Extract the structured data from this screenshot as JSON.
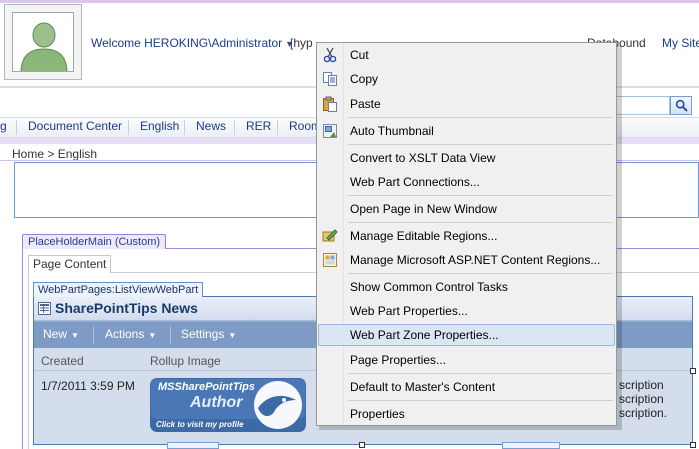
{
  "header": {
    "welcome": "Welcome HEROKING\\Administrator",
    "hyperlink_prefix": "[hyp",
    "databound": "Databound",
    "my_site": "My Site"
  },
  "search": {
    "placeholder": ""
  },
  "nav": {
    "items": [
      "g",
      "Document Center",
      "English",
      "News",
      "RER",
      "Room"
    ]
  },
  "breadcrumb": {
    "home": "Home",
    "separator": ">",
    "current": "English"
  },
  "placeholder": {
    "label": "PlaceHolderMain (Custom)",
    "tab": "Page Content"
  },
  "webpart": {
    "tag": "WebPartPages:ListViewWebPart",
    "title": "SharePointTips News",
    "toolbar": {
      "new": "New",
      "actions": "Actions",
      "settings": "Settings"
    },
    "columns": [
      "Created",
      "Rollup Image"
    ],
    "row": {
      "created": "1/7/2011 3:59 PM",
      "description_lines": [
        "scription",
        "scription",
        "scription."
      ]
    },
    "logo": {
      "brand": "MSSharePointTips",
      "author": "Author",
      "caption": "Click to visit my profile"
    }
  },
  "context_menu": {
    "highlight_color": "#dbe6f4",
    "items": [
      {
        "label": "Cut",
        "icon": "scissors-icon"
      },
      {
        "label": "Copy",
        "icon": "copy-icon"
      },
      {
        "label": "Paste",
        "icon": "paste-icon"
      },
      {
        "label": "Auto Thumbnail",
        "icon": "thumbnail-icon"
      },
      {
        "label": "Convert to XSLT Data View",
        "icon": ""
      },
      {
        "label": "Web Part Connections...",
        "icon": ""
      },
      {
        "label": "Open Page in New Window",
        "icon": ""
      },
      {
        "label": "Manage Editable Regions...",
        "icon": "editable-regions-icon"
      },
      {
        "label": "Manage Microsoft ASP.NET Content Regions...",
        "icon": "content-regions-icon"
      },
      {
        "label": "Show Common Control Tasks",
        "icon": ""
      },
      {
        "label": "Web Part Properties...",
        "icon": ""
      },
      {
        "label": "Web Part Zone Properties...",
        "icon": "",
        "highlighted": true
      },
      {
        "label": "Page Properties...",
        "icon": ""
      },
      {
        "label": "Default to Master's Content",
        "icon": ""
      },
      {
        "label": "Properties",
        "icon": ""
      }
    ]
  }
}
